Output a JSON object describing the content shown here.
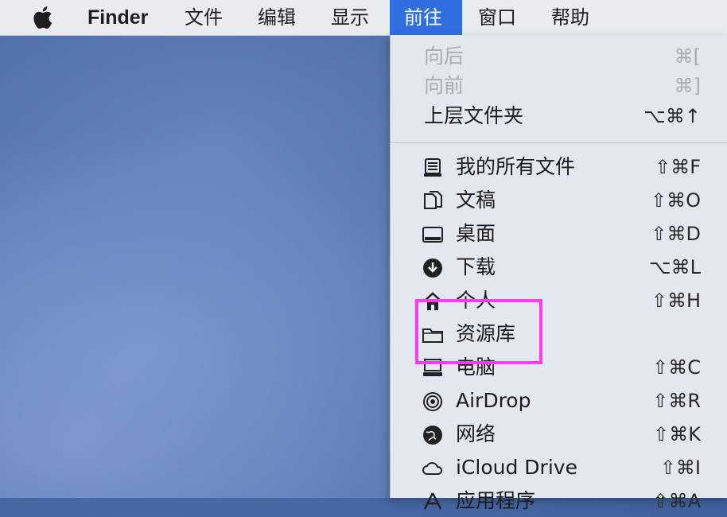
{
  "menubar": {
    "finder": "Finder",
    "file": "文件",
    "edit": "编辑",
    "view": "显示",
    "go": "前往",
    "window": "窗口",
    "help": "帮助"
  },
  "go_menu": {
    "items": [
      {
        "label": "向后",
        "shortcut": "⌘[",
        "enabled": false
      },
      {
        "label": "向前",
        "shortcut": "⌘]",
        "enabled": false
      },
      {
        "label": "上层文件夹",
        "shortcut": "⌥⌘↑",
        "enabled": true
      },
      {
        "label": "我的所有文件",
        "shortcut": "⇧⌘F",
        "icon": "all-files-icon"
      },
      {
        "label": "文稿",
        "shortcut": "⇧⌘O",
        "icon": "documents-icon"
      },
      {
        "label": "桌面",
        "shortcut": "⇧⌘D",
        "icon": "desktop-icon"
      },
      {
        "label": "下载",
        "shortcut": "⌥⌘L",
        "icon": "downloads-icon"
      },
      {
        "label": "个人",
        "shortcut": "⇧⌘H",
        "icon": "home-icon"
      },
      {
        "label": "资源库",
        "shortcut": "",
        "icon": "folder-icon"
      },
      {
        "label": "电脑",
        "shortcut": "⇧⌘C",
        "icon": "computer-icon"
      },
      {
        "label": "AirDrop",
        "shortcut": "⇧⌘R",
        "icon": "airdrop-icon"
      },
      {
        "label": "网络",
        "shortcut": "⇧⌘K",
        "icon": "network-icon"
      },
      {
        "label": "iCloud Drive",
        "shortcut": "⇧⌘I",
        "icon": "icloud-icon"
      },
      {
        "label": "应用程序",
        "shortcut": "⇧⌘A",
        "icon": "applications-icon"
      }
    ]
  },
  "colors": {
    "menu_highlight": "#2f6fe0",
    "annotation_box": "#ff3df0"
  }
}
